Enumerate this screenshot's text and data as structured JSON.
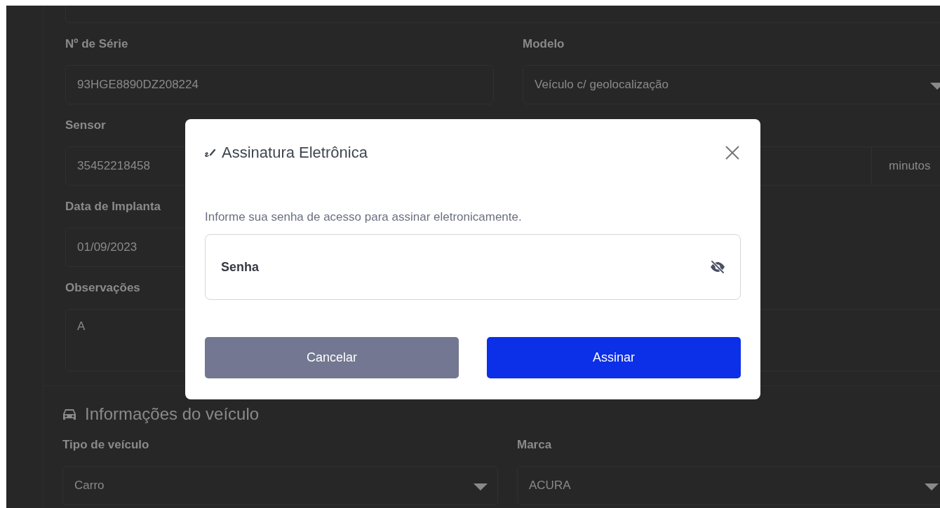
{
  "form": {
    "rows": [
      [
        {
          "kind": "text",
          "label": "Nº de Série",
          "value": "93HGE8890DZ208224"
        },
        {
          "kind": "select",
          "label": "Modelo",
          "value": "Veículo c/ geolocalização"
        }
      ],
      [
        {
          "kind": "text",
          "label": "Sensor",
          "value": "35452218458"
        },
        {
          "kind": "addon",
          "addon": "minutos"
        }
      ],
      [
        {
          "kind": "text",
          "label": "Data de Implanta",
          "value": "01/09/2023"
        }
      ],
      [
        {
          "kind": "textarea",
          "label": "Observações",
          "value": "A"
        }
      ]
    ]
  },
  "vehicle_section": {
    "title": "Informações do veículo",
    "rows": [
      [
        {
          "kind": "select",
          "label": "Tipo de veículo",
          "value": "Carro"
        },
        {
          "kind": "select",
          "label": "Marca",
          "value": "ACURA"
        }
      ]
    ]
  },
  "dialog": {
    "title": "Assinatura Eletrônica",
    "message": "Informe sua senha de acesso para assinar eletronicamente.",
    "password_field": {
      "placeholder": "Senha"
    },
    "buttons": [
      {
        "label": "Cancelar",
        "kind": "secondary"
      },
      {
        "label": "Assinar",
        "kind": "primary"
      }
    ]
  }
}
